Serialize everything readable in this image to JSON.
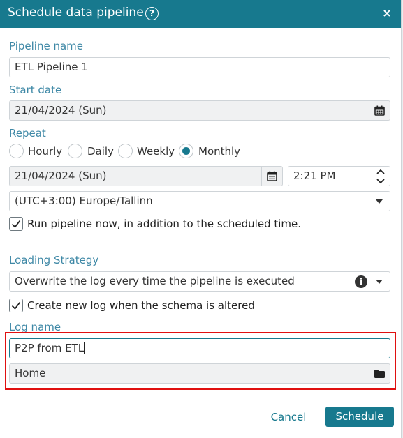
{
  "dialog": {
    "title": "Schedule data pipeline",
    "help_glyph": "?",
    "close_glyph": "×"
  },
  "pipeline_name": {
    "label": "Pipeline name",
    "value": "ETL Pipeline 1"
  },
  "start_date": {
    "label": "Start date",
    "value": "21/04/2024 (Sun)"
  },
  "repeat": {
    "label": "Repeat",
    "options": [
      "Hourly",
      "Daily",
      "Weekly",
      "Monthly"
    ],
    "selected": "Monthly",
    "date_value": "21/04/2024 (Sun)",
    "time_value": "2:21 PM",
    "timezone": "(UTC+3:00) Europe/Tallinn",
    "run_now_label": "Run pipeline now, in addition to the scheduled time.",
    "run_now_checked": true
  },
  "loading_strategy": {
    "label": "Loading Strategy",
    "value": "Overwrite the log every time the pipeline is executed",
    "info_glyph": "i",
    "new_log_label": "Create new log when the schema is altered",
    "new_log_checked": true
  },
  "log_name": {
    "label": "Log name",
    "value": "P2P from ETL",
    "location": "Home"
  },
  "actions": {
    "cancel_label": "Cancel",
    "schedule_label": "Schedule"
  },
  "colors": {
    "accent": "#17798e",
    "label": "#3e88a6",
    "highlight": "#e01010"
  }
}
